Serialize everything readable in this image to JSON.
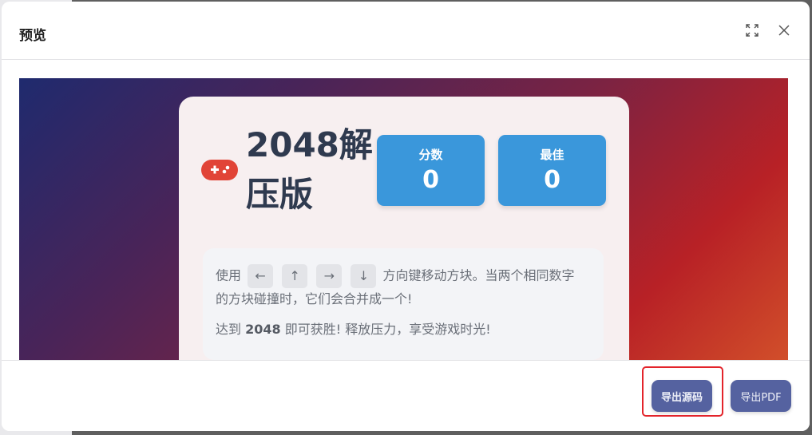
{
  "modal": {
    "title": "预览",
    "icons": {
      "expand": "fullscreen-icon",
      "close": "close-icon"
    }
  },
  "game": {
    "icon": "gamepad-icon",
    "title": "2048解压版",
    "score": {
      "label": "分数",
      "value": "0"
    },
    "best": {
      "label": "最佳",
      "value": "0"
    },
    "instructions": {
      "line1_prefix": "使用",
      "keys": [
        "←",
        "↑",
        "→",
        "↓"
      ],
      "line1_suffix": "方向键移动方块。当两个相同数字",
      "line2": "的方块碰撞时，它们会合并成一个!",
      "line3_prefix": "达到",
      "line3_highlight": "2048",
      "line3_suffix": "即可获胜! 释放压力，享受游戏时光!"
    }
  },
  "footer": {
    "export_source": "导出源码",
    "export_pdf": "导出PDF"
  },
  "colors": {
    "score_box": "#3a97db",
    "button": "#5562a0",
    "highlight": "#e3242b",
    "gamepad": "#e14437"
  }
}
